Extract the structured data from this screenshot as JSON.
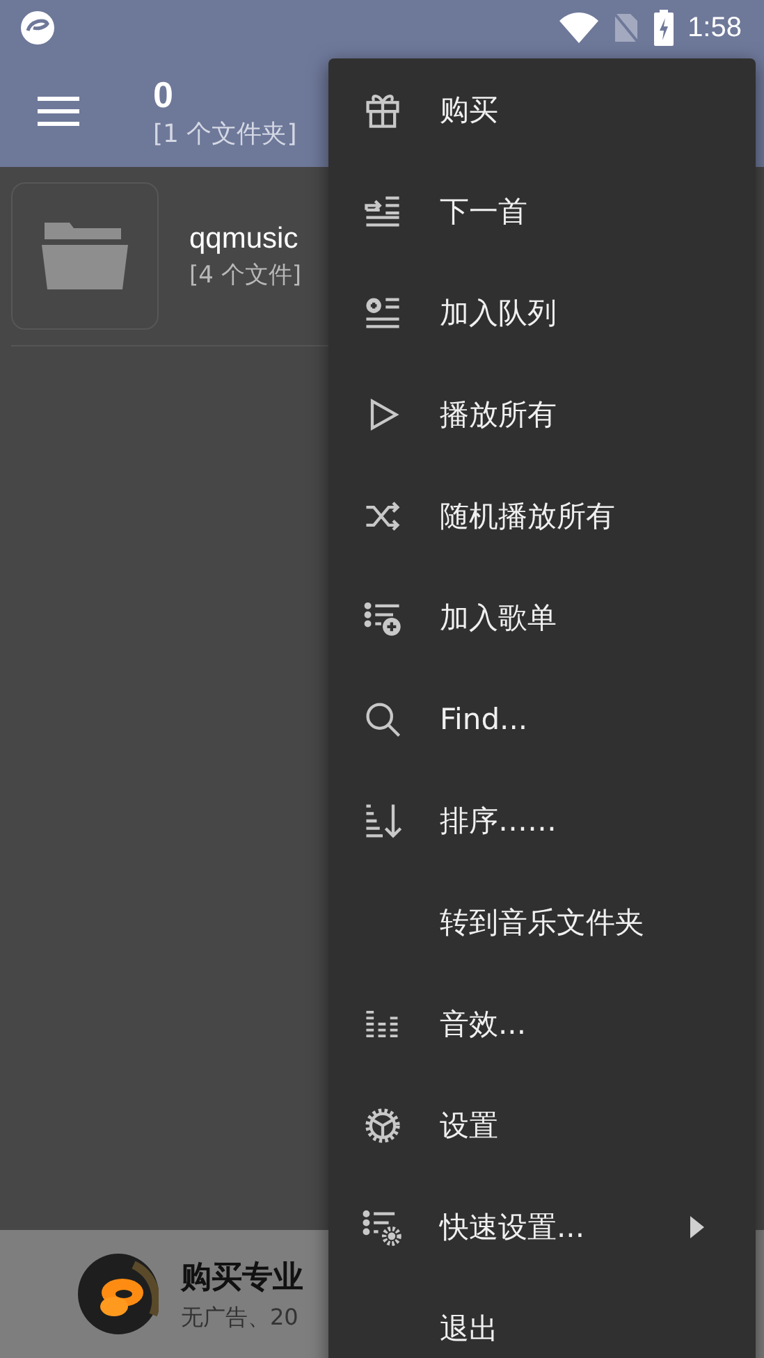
{
  "status_bar": {
    "time": "1:58"
  },
  "app_bar": {
    "title": "0",
    "subtitle": "[1 个文件夹]"
  },
  "folders": [
    {
      "name": "qqmusic",
      "count": "[4 个文件]"
    }
  ],
  "banner": {
    "title": "购买专业",
    "subtitle": "无广告、20"
  },
  "menu": [
    {
      "label": "购买",
      "submenu": false
    },
    {
      "label": "下一首",
      "submenu": false
    },
    {
      "label": "加入队列",
      "submenu": false
    },
    {
      "label": "播放所有",
      "submenu": false
    },
    {
      "label": "随机播放所有",
      "submenu": false
    },
    {
      "label": "加入歌单",
      "submenu": false
    },
    {
      "label": "Find...",
      "submenu": false
    },
    {
      "label": "排序……",
      "submenu": false
    },
    {
      "label": "转到音乐文件夹",
      "submenu": false
    },
    {
      "label": "音效...",
      "submenu": false
    },
    {
      "label": "设置",
      "submenu": false
    },
    {
      "label": "快速设置...",
      "submenu": true
    },
    {
      "label": "退出",
      "submenu": false
    }
  ]
}
